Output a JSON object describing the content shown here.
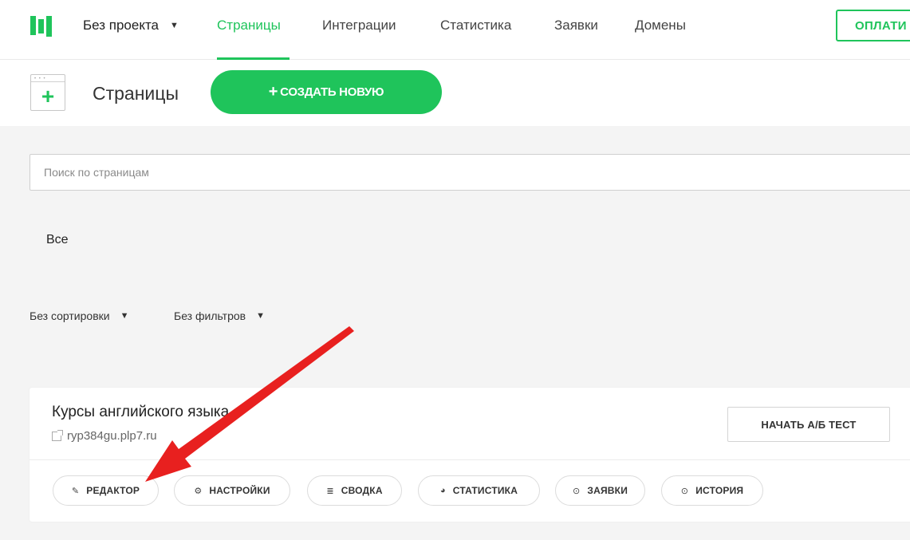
{
  "topbar": {
    "project": "Без проекта",
    "nav": [
      "Страницы",
      "Интеграции",
      "Статистика",
      "Заявки",
      "Домены"
    ],
    "pay_label": "ОПЛАТИ"
  },
  "subbar": {
    "title": "Страницы",
    "create_label": "СОЗДАТЬ НОВУЮ",
    "create_icon": "+"
  },
  "search": {
    "placeholder": "Поиск по страницам"
  },
  "tabs": {
    "all": "Все"
  },
  "sort": {
    "label": "Без сортировки"
  },
  "filter": {
    "label": "Без фильтров"
  },
  "card": {
    "title": "Курсы английского языка",
    "url": "ryp384gu.plp7.ru",
    "ab_label": "НАЧАТЬ А/Б ТЕСТ",
    "actions": [
      {
        "label": "РЕДАКТОР",
        "icon": "edit-icon"
      },
      {
        "label": "НАСТРОЙКИ",
        "icon": "gear-icon"
      },
      {
        "label": "СВОДКА",
        "icon": "list-icon"
      },
      {
        "label": "СТАТИСТИКА",
        "icon": "pie-chart-icon"
      },
      {
        "label": "ЗАЯВКИ",
        "icon": "check-circle-icon"
      },
      {
        "label": "ИСТОРИЯ",
        "icon": "check-circle-icon"
      }
    ]
  },
  "colors": {
    "accent": "#1fc45b",
    "arrow": "#e8201f",
    "background": "#f4f4f4"
  }
}
